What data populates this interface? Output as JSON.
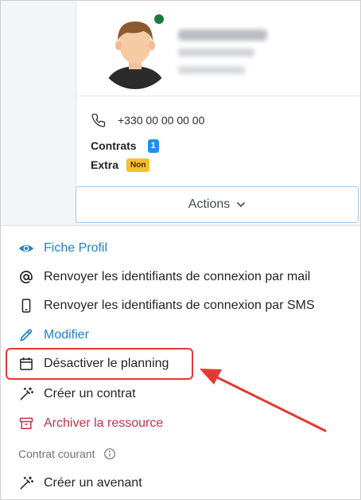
{
  "profile": {
    "phone": "+330 00 00 00 00",
    "contrats_label": "Contrats",
    "contrats_count": "1",
    "extra_label": "Extra",
    "extra_value": "Non"
  },
  "actions": {
    "label": "Actions"
  },
  "menu": {
    "fiche_profil": "Fiche Profil",
    "renvoyer_mail": "Renvoyer les identifiants de connexion par mail",
    "renvoyer_sms": "Renvoyer les identifiants de connexion par SMS",
    "modifier": "Modifier",
    "desactiver_planning": "Désactiver le planning",
    "creer_contrat": "Créer un contrat",
    "archiver": "Archiver la ressource",
    "section_label": "Contrat courant",
    "creer_avenant": "Créer un avenant"
  },
  "colors": {
    "link_blue": "#1c82c9",
    "danger_red": "#c62f4d",
    "badge_blue": "#1f8ff0",
    "badge_yellow": "#f7c02a",
    "status_green": "#1a7a43",
    "annotation_red": "#e53935"
  },
  "icons": {
    "phone": "phone-icon",
    "eye": "eye-icon",
    "at": "at-sign-icon",
    "mobile": "mobile-phone-icon",
    "pencil": "pencil-icon",
    "calendar": "calendar-icon",
    "magic_wand": "magic-wand-icon",
    "archive": "archive-box-icon",
    "info": "info-circle-icon",
    "chevron": "chevron-down-icon"
  }
}
